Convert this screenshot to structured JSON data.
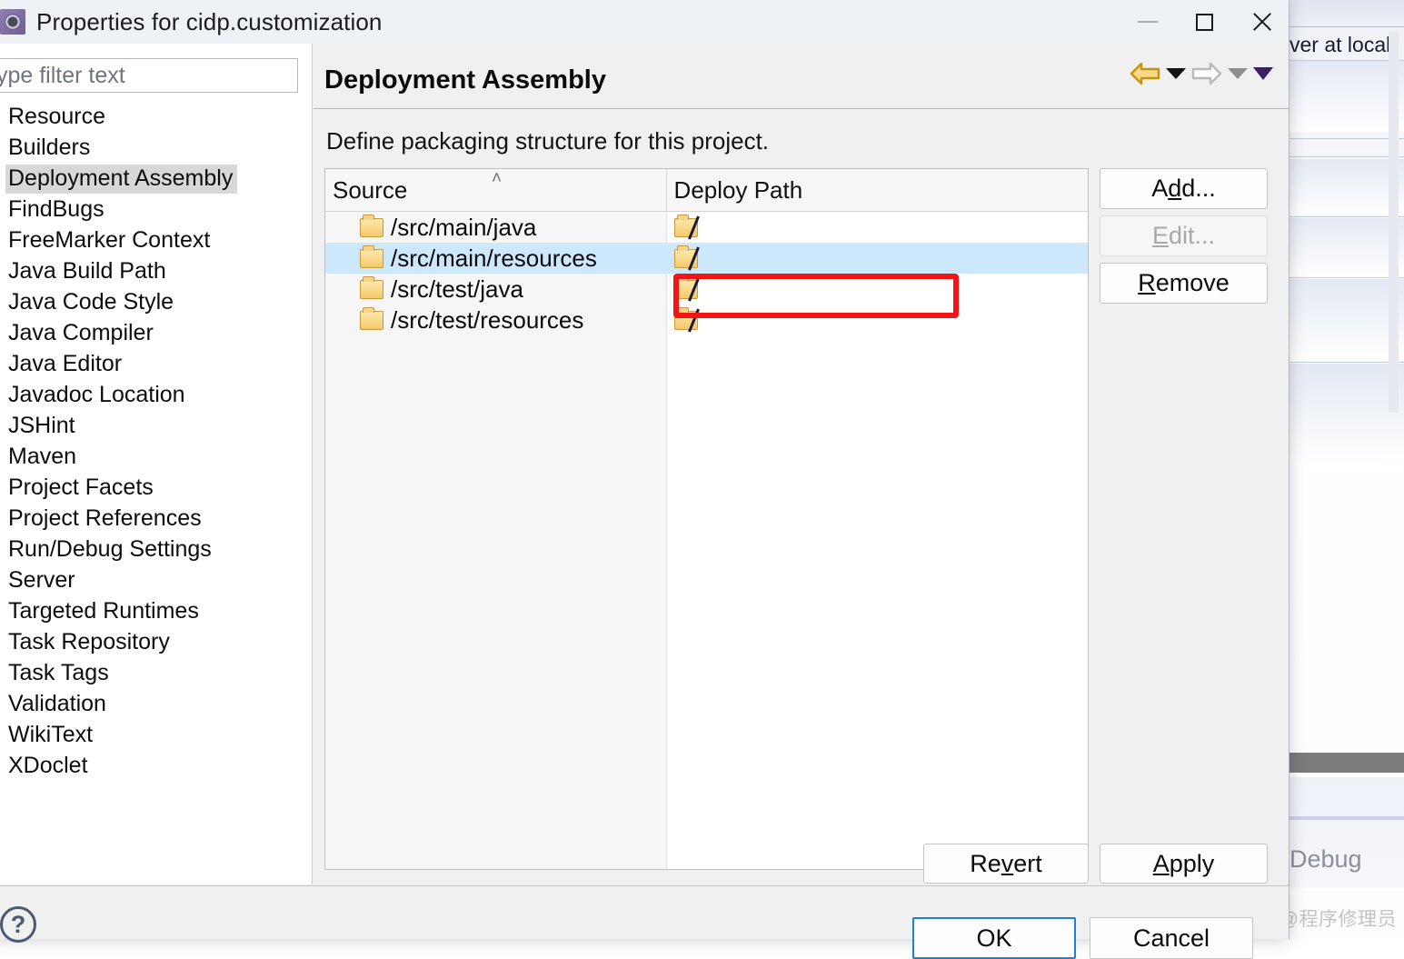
{
  "window": {
    "title": "Properties for cidp.customization",
    "icon": "eclipse-properties-icon",
    "minimize": "—",
    "maximize": "□",
    "close": "✕"
  },
  "sidebar": {
    "filter_placeholder": "type filter text",
    "filter_value": "",
    "items": [
      {
        "label": "Resource",
        "expandable": true,
        "selected": false
      },
      {
        "label": "Builders",
        "expandable": false,
        "selected": false
      },
      {
        "label": "Deployment Assembly",
        "expandable": false,
        "selected": true
      },
      {
        "label": "FindBugs",
        "expandable": false,
        "selected": false
      },
      {
        "label": "FreeMarker Context",
        "expandable": false,
        "selected": false
      },
      {
        "label": "Java Build Path",
        "expandable": false,
        "selected": false
      },
      {
        "label": "Java Code Style",
        "expandable": true,
        "selected": false
      },
      {
        "label": "Java Compiler",
        "expandable": true,
        "selected": false
      },
      {
        "label": "Java Editor",
        "expandable": true,
        "selected": false
      },
      {
        "label": "Javadoc Location",
        "expandable": false,
        "selected": false
      },
      {
        "label": "JSHint",
        "expandable": true,
        "selected": false
      },
      {
        "label": "Maven",
        "expandable": true,
        "selected": false
      },
      {
        "label": "Project Facets",
        "expandable": false,
        "selected": false
      },
      {
        "label": "Project References",
        "expandable": false,
        "selected": false
      },
      {
        "label": "Run/Debug Settings",
        "expandable": false,
        "selected": false
      },
      {
        "label": "Server",
        "expandable": false,
        "selected": false
      },
      {
        "label": "Targeted Runtimes",
        "expandable": false,
        "selected": false
      },
      {
        "label": "Task Repository",
        "expandable": true,
        "selected": false
      },
      {
        "label": "Task Tags",
        "expandable": false,
        "selected": false
      },
      {
        "label": "Validation",
        "expandable": true,
        "selected": false
      },
      {
        "label": "WikiText",
        "expandable": false,
        "selected": false
      },
      {
        "label": "XDoclet",
        "expandable": true,
        "selected": false
      }
    ],
    "expander_glyph": "›"
  },
  "page": {
    "title": "Deployment Assembly",
    "description": "Define packaging structure for this project.",
    "nav": {
      "back_icon": "back-arrow-icon",
      "back_menu_icon": "chevron-down-icon",
      "forward_icon": "forward-arrow-icon",
      "forward_menu_icon": "chevron-down-icon",
      "more_menu_icon": "chevron-down-icon"
    }
  },
  "table": {
    "columns": [
      {
        "key": "source",
        "label": "Source",
        "sorted": true,
        "sort_glyph": "˄"
      },
      {
        "key": "deploy",
        "label": "Deploy Path",
        "sorted": false,
        "sort_glyph": ""
      }
    ],
    "rows": [
      {
        "source": "/src/main/java",
        "source_icon": "folder-icon",
        "deploy": "",
        "deploy_icon": "folder-root-icon",
        "selected": false
      },
      {
        "source": "/src/main/resources",
        "source_icon": "folder-icon",
        "deploy": "",
        "deploy_icon": "folder-root-icon",
        "selected": true
      },
      {
        "source": "/src/test/java",
        "source_icon": "folder-icon",
        "deploy": "",
        "deploy_icon": "folder-root-icon",
        "selected": false
      },
      {
        "source": "/src/test/resources",
        "source_icon": "folder-icon",
        "deploy": "",
        "deploy_icon": "folder-root-icon",
        "selected": false
      }
    ],
    "empty_row_count": 18
  },
  "buttons": {
    "add": {
      "pre": "A",
      "mn": "d",
      "post": "d...",
      "enabled": true
    },
    "edit": {
      "pre": "",
      "mn": "E",
      "post": "dit...",
      "enabled": false
    },
    "remove": {
      "pre": "",
      "mn": "R",
      "post": "emove",
      "enabled": true
    },
    "revert": {
      "pre": "Re",
      "mn": "v",
      "post": "ert",
      "enabled": true
    },
    "apply": {
      "pre": "",
      "mn": "A",
      "post": "pply",
      "enabled": true
    },
    "ok": "OK",
    "cancel": "Cancel",
    "help_glyph": "?"
  },
  "background": {
    "ide_title_partial": "ver at local",
    "ide_perspective": "Debug",
    "watermark": "CSDN @程序修理员"
  },
  "colors": {
    "selection_blue": "#cde8fb",
    "annotation_red": "#f41414",
    "default_button_border": "#1f7fd4",
    "back_arrow_gold": "#d8a013",
    "forward_arrow_grey": "#b6b6b6"
  },
  "annotation": {
    "shape": "rectangle",
    "target": "/src/main/resources",
    "color": "#f41414"
  }
}
